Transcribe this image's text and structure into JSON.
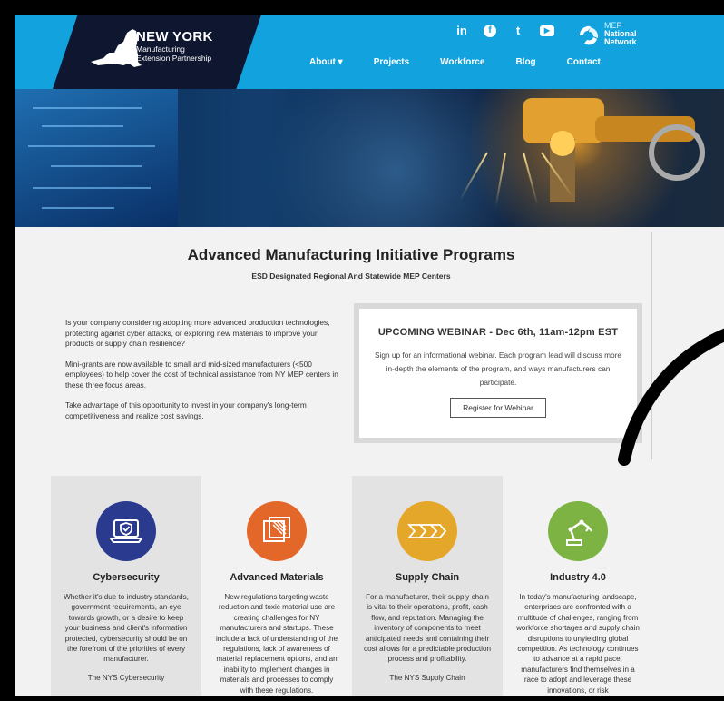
{
  "header": {
    "brand_title": "NEW YORK",
    "brand_sub_line1": "Manufacturing",
    "brand_sub_line2": "Extension Partnership",
    "social": {
      "linkedin": "in",
      "facebook": "f",
      "twitter": "t",
      "youtube": "▶"
    },
    "mep": {
      "small": "MEP",
      "line1": "National",
      "line2": "Network"
    },
    "nav": [
      {
        "label": "About ▾"
      },
      {
        "label": "Projects"
      },
      {
        "label": "Workforce"
      },
      {
        "label": "Blog"
      },
      {
        "label": "Contact"
      }
    ]
  },
  "main": {
    "title": "Advanced Manufacturing Initiative Programs",
    "subtitle": "ESD Designated Regional And Statewide MEP Centers",
    "intro": [
      "Is your company considering adopting more advanced production technologies, protecting against cyber attacks, or exploring new materials to improve your products or supply chain resilience?",
      "Mini-grants are now available to small and mid-sized manufacturers (<500 employees) to help cover the cost of technical assistance from NY MEP centers in these three focus areas.",
      "Take advantage of this opportunity to invest in your company's long-term competitiveness and realize cost savings."
    ]
  },
  "webinar": {
    "title": "UPCOMING WEBINAR - Dec 6th, 11am-12pm EST",
    "text": "Sign up for an informational webinar. Each program lead will discuss more in-depth the elements of the program, and ways manufacturers can participate.",
    "button": "Register for Webinar"
  },
  "cards": [
    {
      "title": "Cybersecurity",
      "color": "#2a3a8f",
      "icon": "laptop-shield-icon",
      "text": "Whether it's due to industry standards, government requirements, an eye towards growth, or a desire to keep your business and client's information protected, cybersecurity should be on the forefront of the priorities of every manufacturer.",
      "text2": "The NYS Cybersecurity"
    },
    {
      "title": "Advanced Materials",
      "color": "#e4672a",
      "icon": "materials-icon",
      "text": "New regulations targeting waste reduction and toxic material use are creating challenges for NY manufacturers and startups. These include a lack of understanding of the regulations, lack of awareness of material replacement options, and an inability to implement changes in materials and processes to comply with these regulations.",
      "text2": ""
    },
    {
      "title": "Supply Chain",
      "color": "#e5a72a",
      "icon": "arrows-icon",
      "text": "For a manufacturer, their supply chain is vital to their operations, profit, cash flow, and reputation. Managing the inventory of components to meet anticipated needs and containing their cost allows for a predictable production process and profitability.",
      "text2": "The NYS Supply Chain"
    },
    {
      "title": "Industry 4.0",
      "color": "#7cb342",
      "icon": "robot-arm-icon",
      "text": "In today's manufacturing landscape, enterprises are confronted with a multitude of challenges, ranging from workforce shortages and supply chain disruptions to unyielding global competition. As technology continues to advance at a rapid pace, manufacturers find themselves in a race to adopt and leverage these innovations, or risk",
      "text2": ""
    }
  ]
}
